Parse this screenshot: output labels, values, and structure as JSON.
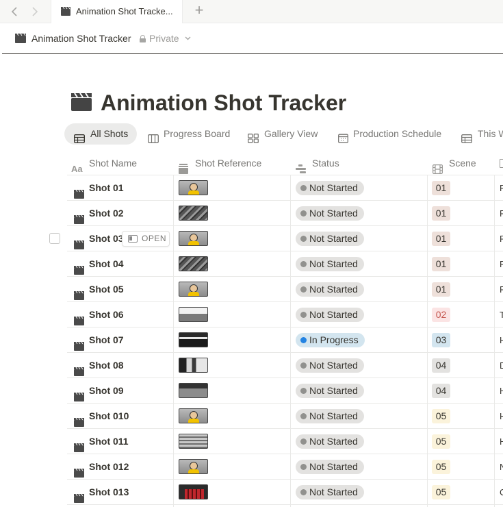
{
  "browser": {
    "tab_title": "Animation Shot Tracke...",
    "back_icon": "chevron-left-icon",
    "forward_icon": "chevron-right-icon",
    "new_tab_label": "+"
  },
  "topbar": {
    "breadcrumb": "Animation Shot Tracker",
    "privacy": "Private"
  },
  "page": {
    "title": "Animation Shot Tracker",
    "icon": "clapperboard-icon"
  },
  "views": [
    {
      "label": "All Shots",
      "icon": "table-icon"
    },
    {
      "label": "Progress Board",
      "icon": "board-icon"
    },
    {
      "label": "Gallery View",
      "icon": "gallery-icon"
    },
    {
      "label": "Production Schedule",
      "icon": "calendar-icon"
    },
    {
      "label": "This W",
      "icon": "table-icon"
    }
  ],
  "columns": [
    {
      "label": "Shot Name",
      "icon": "text-type-icon"
    },
    {
      "label": "Shot Reference",
      "icon": "files-icon"
    },
    {
      "label": "Status",
      "icon": "status-icon"
    },
    {
      "label": "Scene",
      "icon": "film-icon"
    }
  ],
  "row_hover": {
    "open_label": "OPEN"
  },
  "rows": [
    {
      "name": "Shot 01",
      "status": "Not Started",
      "scene": "01",
      "trail": "F"
    },
    {
      "name": "Shot 02",
      "status": "Not Started",
      "scene": "01",
      "trail": "F"
    },
    {
      "name": "Shot 03",
      "status": "Not Started",
      "scene": "01",
      "trail": "F"
    },
    {
      "name": "Shot 04",
      "status": "Not Started",
      "scene": "01",
      "trail": "F"
    },
    {
      "name": "Shot 05",
      "status": "Not Started",
      "scene": "01",
      "trail": "F"
    },
    {
      "name": "Shot 06",
      "status": "Not Started",
      "scene": "02",
      "trail": "T"
    },
    {
      "name": "Shot 07",
      "status": "In Progress",
      "scene": "03",
      "trail": "H"
    },
    {
      "name": "Shot 08",
      "status": "Not Started",
      "scene": "04",
      "trail": "D"
    },
    {
      "name": "Shot 09",
      "status": "Not Started",
      "scene": "04",
      "trail": "H"
    },
    {
      "name": "Shot 010",
      "status": "Not Started",
      "scene": "05",
      "trail": "H"
    },
    {
      "name": "Shot 011",
      "status": "Not Started",
      "scene": "05",
      "trail": "H"
    },
    {
      "name": "Shot 012",
      "status": "Not Started",
      "scene": "05",
      "trail": "N"
    },
    {
      "name": "Shot 013",
      "status": "Not Started",
      "scene": "05",
      "trail": "C"
    }
  ],
  "colors": {
    "not_started_bg": "#e3e2e0",
    "not_started_dot": "#91918e",
    "in_progress_bg": "#d3e5ef",
    "in_progress_dot": "#2383e2",
    "scene_01_bg": "#eee0da",
    "scene_02_bg": "#fbe4e4",
    "scene_02_text": "#c4554d",
    "scene_03_bg": "#d3e5ef",
    "scene_04_bg": "#e3e2e0",
    "scene_05_bg": "#fbf3db",
    "text": "#37352f"
  }
}
